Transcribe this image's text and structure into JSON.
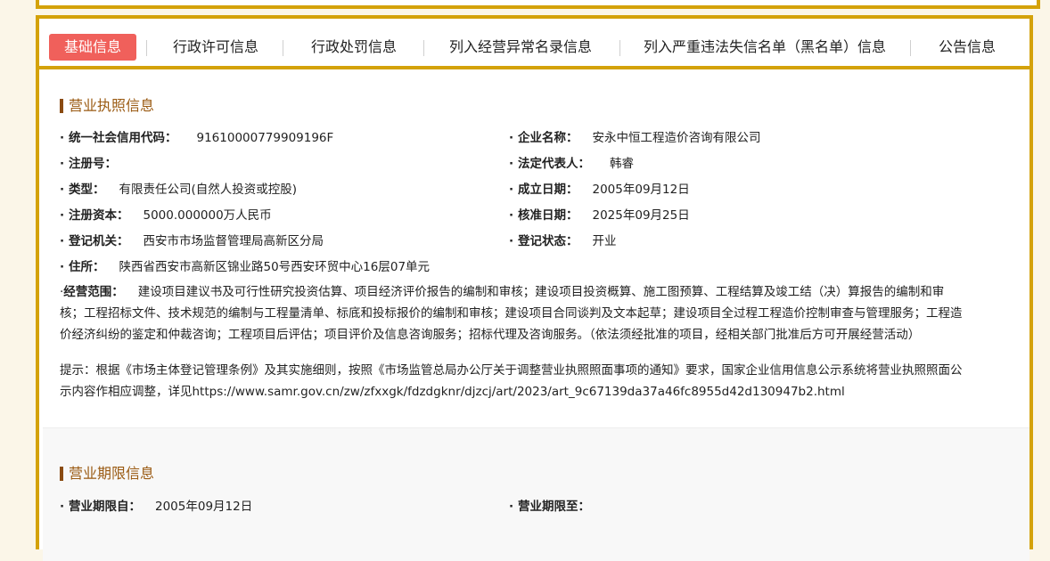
{
  "tabs": [
    {
      "label": "基础信息",
      "active": true
    },
    {
      "label": "行政许可信息",
      "active": false
    },
    {
      "label": "行政处罚信息",
      "active": false
    },
    {
      "label": "列入经营异常名录信息",
      "active": false
    },
    {
      "label": "列入严重违法失信名单（黑名单）信息",
      "active": false
    },
    {
      "label": "公告信息",
      "active": false
    }
  ],
  "license": {
    "title": "营业执照信息",
    "credit_code_label": "统一社会信用代码：",
    "credit_code": "91610000779909196F",
    "name_label": "企业名称：",
    "name": "安永中恒工程造价咨询有限公司",
    "reg_no_label": "注册号：",
    "reg_no": "",
    "legal_rep_label": "法定代表人：",
    "legal_rep": "韩睿",
    "type_label": "类型：",
    "type": "有限责任公司(自然人投资或控股)",
    "est_date_label": "成立日期：",
    "est_date": "2005年09月12日",
    "capital_label": "注册资本：",
    "capital": "5000.000000万人民币",
    "approve_date_label": "核准日期：",
    "approve_date": "2025年09月25日",
    "authority_label": "登记机关：",
    "authority": "西安市市场监督管理局高新区分局",
    "status_label": "登记状态：",
    "status": "开业",
    "address_label": "住所：",
    "address": "陕西省西安市高新区锦业路50号西安环贸中心16层07单元",
    "scope_label": "经营范围：",
    "scope_line1": "建设项目建议书及可行性研究投资估算、项目经济评价报告的编制和审核；建设项目投资概算、施工图预算、工程结算及竣工结（决）算报告的编制和审",
    "scope_line2": "核；工程招标文件、技术规范的编制与工程量清单、标底和投标报价的编制和审核；建设项目合同谈判及文本起草；建设项目全过程工程造价控制审查与管理服务；工程造",
    "scope_line3": "价经济纠纷的鉴定和仲裁咨询；工程项目后评估；项目评价及信息咨询服务；招标代理及咨询服务。（依法须经批准的项目，经相关部门批准后方可开展经营活动）",
    "notice_line1": "提示：根据《市场主体登记管理条例》及其实施细则，按照《市场监管总局办公厅关于调整营业执照照面事项的通知》要求，国家企业信用信息公示系统将营业执照照面公",
    "notice_line2": "示内容作相应调整，详见https://www.samr.gov.cn/zw/zfxxgk/fdzdgknr/djzcj/art/2023/art_9c67139da37a46fc8955d42d130947b2.html"
  },
  "term": {
    "title": "营业期限信息",
    "from_label": "营业期限自：",
    "from": "2005年09月12日",
    "to_label": "营业期限至：",
    "to": ""
  },
  "colors": {
    "accent": "#d4a20a",
    "active_tab": "#f0605b",
    "section_title": "#9a5a12"
  }
}
